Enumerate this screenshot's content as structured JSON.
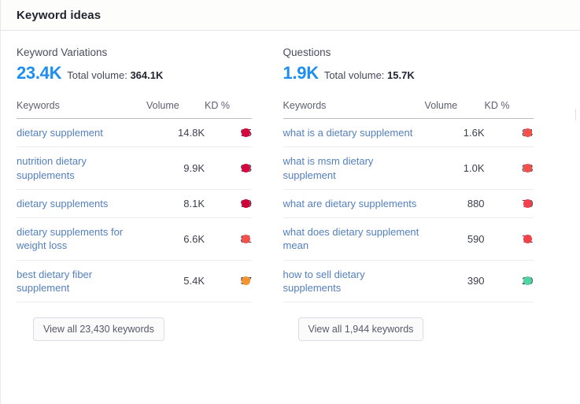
{
  "header": {
    "title": "Keyword ideas"
  },
  "colors": {
    "accent_blue": "#1e8ef0",
    "link_blue": "#5480bd",
    "kd_crimson": "#d6063f",
    "kd_red_light": "#f4504c",
    "kd_red": "#f2414a",
    "kd_orange": "#f59331",
    "kd_green": "#4fd4a0"
  },
  "panels": [
    {
      "label": "Keyword Variations",
      "count": "23.4K",
      "total_volume_label": "Total volume:",
      "total_volume": "364.1K",
      "columns": {
        "keywords": "Keywords",
        "volume": "Volume",
        "kd": "KD %"
      },
      "rows": [
        {
          "keyword": "dietary supplement",
          "volume": "14.8K",
          "kd": "95",
          "kd_color": "#d6063f"
        },
        {
          "keyword": "nutrition dietary supplements",
          "volume": "9.9K",
          "kd": "93",
          "kd_color": "#d6063f"
        },
        {
          "keyword": "dietary supplements",
          "volume": "8.1K",
          "kd": "99",
          "kd_color": "#d00039"
        },
        {
          "keyword": "dietary supplements for weight loss",
          "volume": "6.6K",
          "kd": "81",
          "kd_color": "#f4504c"
        },
        {
          "keyword": "best dietary fiber supplement",
          "volume": "5.4K",
          "kd": "57",
          "kd_color": "#f59331"
        }
      ],
      "view_all_label": "View all 23,430 keywords"
    },
    {
      "label": "Questions",
      "count": "1.9K",
      "total_volume_label": "Total volume:",
      "total_volume": "15.7K",
      "columns": {
        "keywords": "Keywords",
        "volume": "Volume",
        "kd": "KD %"
      },
      "rows": [
        {
          "keyword": "what is a dietary supplement",
          "volume": "1.6K",
          "kd": "84",
          "kd_color": "#f4504c"
        },
        {
          "keyword": "what is msm dietary supplement",
          "volume": "1.0K",
          "kd": "83",
          "kd_color": "#f4504c"
        },
        {
          "keyword": "what are dietary supplements",
          "volume": "880",
          "kd": "70",
          "kd_color": "#f2414a"
        },
        {
          "keyword": "what does dietary supplement mean",
          "volume": "590",
          "kd": "71",
          "kd_color": "#f2414a"
        },
        {
          "keyword": "how to sell dietary supplements",
          "volume": "390",
          "kd": "29",
          "kd_color": "#4fd4a0"
        }
      ],
      "view_all_label": "View all 1,944 keywords"
    }
  ]
}
